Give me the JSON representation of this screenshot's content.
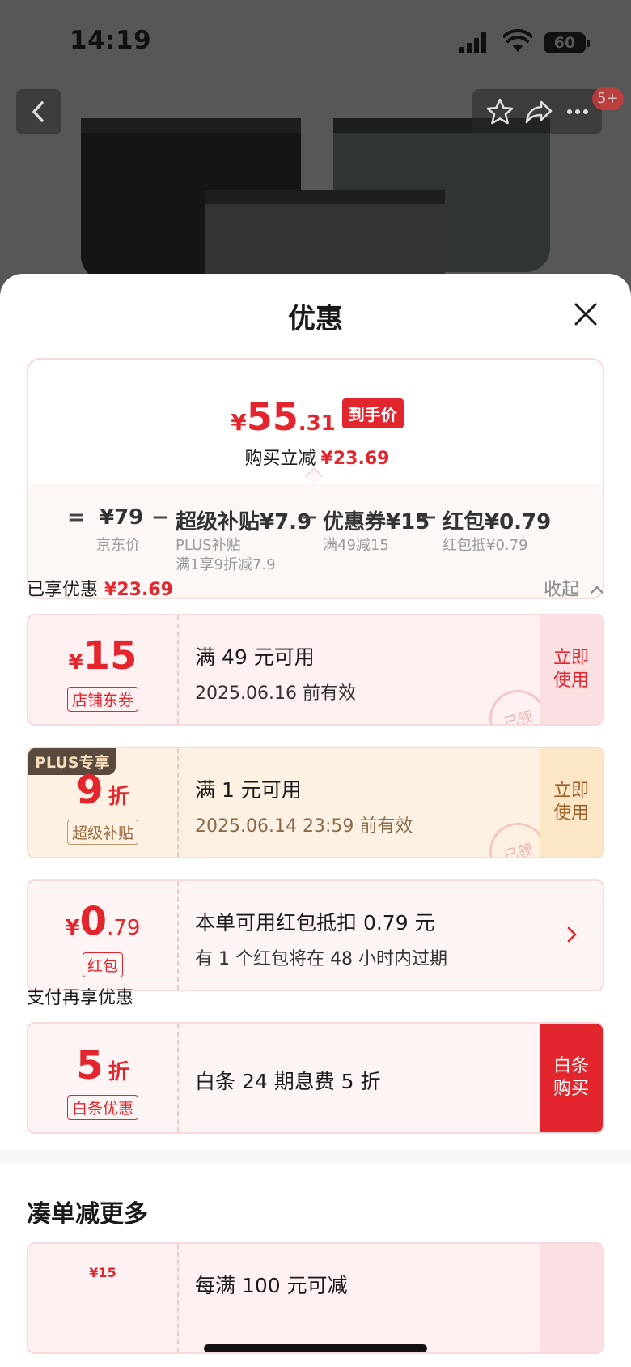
{
  "status": {
    "time": "14:19",
    "battery": "60"
  },
  "nav": {
    "cart_badge": "5+"
  },
  "sheet": {
    "title": "优惠"
  },
  "summary": {
    "price_yen": "¥",
    "price_int": "55",
    "price_dec": ".31",
    "price_tag": "到手价",
    "reduce_label": "购买立减",
    "reduce_amount": "¥23.69",
    "formula": {
      "eq": "=",
      "base_value": "¥79",
      "base_label": "京东价",
      "minus": "−",
      "item1_value": "超级补贴¥7.9",
      "item1_label_1": "PLUS补贴",
      "item1_label_2": "满1享9折减7.9",
      "item2_value": "优惠券¥15",
      "item2_label": "满49减15",
      "item3_value": "红包¥0.79",
      "item3_label": "红包抵¥0.79"
    }
  },
  "enjoyed": {
    "label": "已享优惠",
    "amount": "¥23.69",
    "collapse": "收起"
  },
  "coupons": [
    {
      "symbol": "¥",
      "amount": "15",
      "tag": "店铺东券",
      "title": "满 49 元可用",
      "subtitle": "2025.06.16 前有效",
      "button": "立即使用",
      "stamp": "已领"
    },
    {
      "plus": "PLUS专享",
      "amount": "9",
      "unit": "折",
      "tag": "超级补贴",
      "title": "满 1 元可用",
      "subtitle": "2025.06.14 23:59 前有效",
      "button": "立即使用",
      "stamp": "已领"
    },
    {
      "symbol": "¥",
      "amount": "0",
      "decimal": ".79",
      "tag": "红包",
      "title": "本单可用红包抵扣 0.79 元",
      "subtitle": "有 1 个红包将在 48 小时内过期"
    }
  ],
  "pay_section": {
    "label": "支付再享优惠"
  },
  "pay_coupon": {
    "amount": "5",
    "unit": "折",
    "tag": "白条优惠",
    "title": "白条 24 期息费 5 折",
    "button": "白条购买"
  },
  "more": {
    "title": "凑单减更多",
    "partial_amount": "¥15",
    "partial_title": "每满 100 元可减"
  },
  "colors": {
    "accent": "#e3262e",
    "plus_bg": "#fdf1e3",
    "dim_bg": "#575757"
  }
}
